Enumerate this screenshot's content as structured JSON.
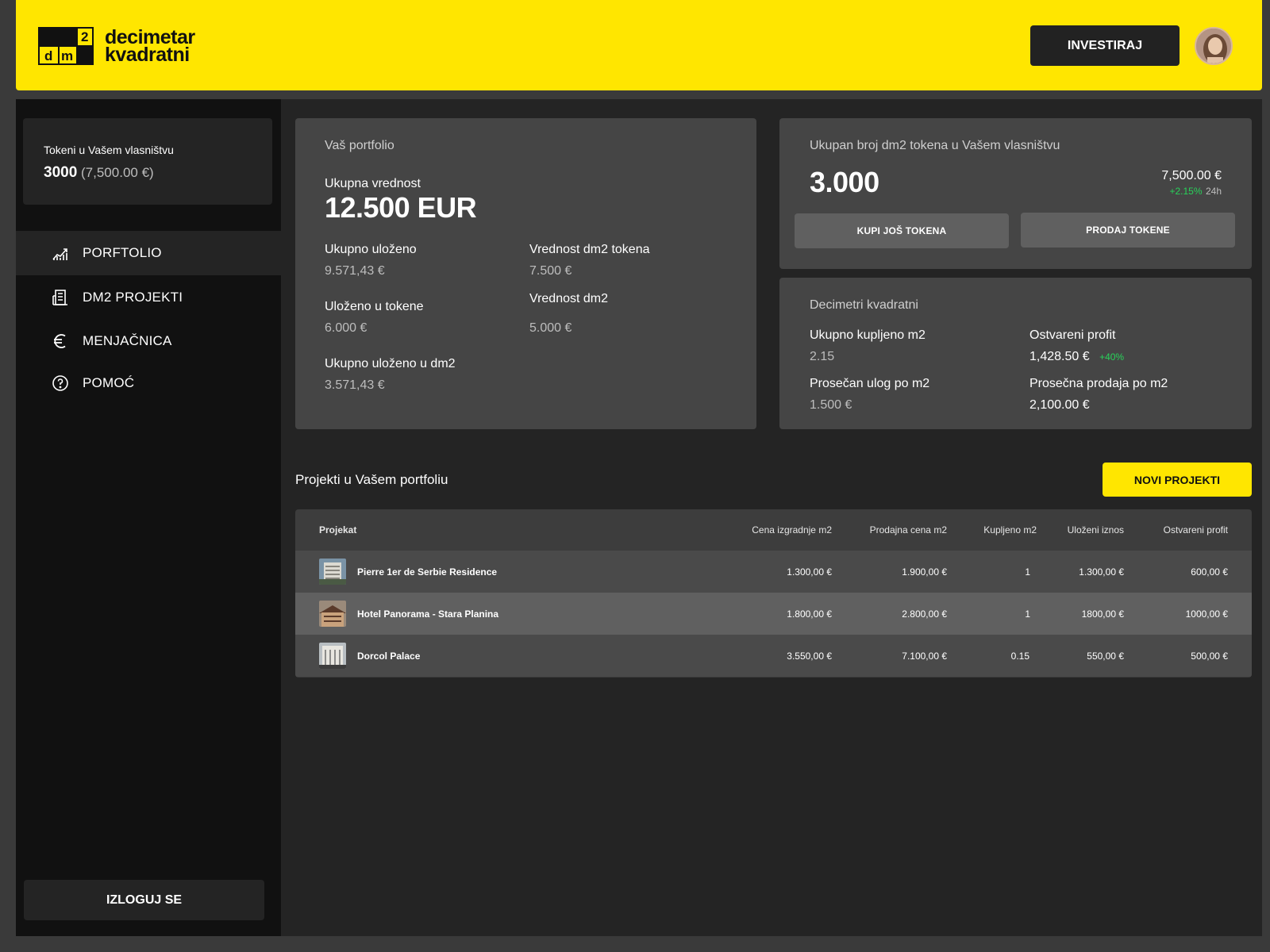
{
  "brand": {
    "logo_text_1": "decimetar",
    "logo_text_2": "kvadratni",
    "mark_sup": "2",
    "mark_d": "d",
    "mark_m": "m"
  },
  "header": {
    "invest_label": "INVESTIRAJ"
  },
  "sidebar": {
    "tokens_label": "Tokeni u Vašem vlasništvu",
    "tokens_count": "3000",
    "tokens_value": "(7,500.00 €)",
    "nav": [
      {
        "label": "PORFTOLIO",
        "icon": "chart-icon",
        "active": true
      },
      {
        "label": "DM2 PROJEKTI",
        "icon": "building-icon",
        "active": false
      },
      {
        "label": "MENJAČNICA",
        "icon": "euro-icon",
        "active": false
      },
      {
        "label": "POMOĆ",
        "icon": "help-icon",
        "active": false
      }
    ],
    "logout_label": "IZLOGUJ SE"
  },
  "portfolio": {
    "title": "Vaš portfolio",
    "total_label": "Ukupna vrednost",
    "total_value": "12.500 EUR",
    "invested_label": "Ukupno uloženo",
    "invested_value": "9.571,43 €",
    "token_value_label": "Vrednost dm2 tokena",
    "token_value": "7.500 €",
    "in_tokens_label": "Uloženo u tokene",
    "in_tokens_value": "6.000 €",
    "dm2_value_label": "Vrednost dm2",
    "dm2_value": "5.000 €",
    "in_dm2_label": "Ukupno uloženo u dm2",
    "in_dm2_value": "3.571,43 €"
  },
  "tokens_card": {
    "title": "Ukupan broj dm2 tokena u Vašem vlasništvu",
    "count": "3.000",
    "value": "7,500.00 €",
    "change": "+2.15%",
    "period": "24h",
    "buy_label": "KUPI JOŠ TOKENA",
    "sell_label": "PRODAJ TOKENE"
  },
  "dm2_card": {
    "title": "Decimetri kvadratni",
    "bought_label": "Ukupno kupljeno m2",
    "bought_value": "2.15",
    "profit_label": "Ostvareni profit",
    "profit_value": "1,428.50 €",
    "profit_change": "+40%",
    "avg_in_label": "Prosečan ulog po m2",
    "avg_in_value": "1.500 €",
    "avg_sale_label": "Prosečna prodaja po m2",
    "avg_sale_value": "2,100.00 €"
  },
  "projects": {
    "section_title": "Projekti u Vašem portfoliu",
    "new_projects_label": "NOVI PROJEKTI",
    "columns": [
      "Projekat",
      "Cena izgradnje m2",
      "Prodajna cena m2",
      "Kupljeno m2",
      "Uloženi iznos",
      "Ostvareni profit"
    ],
    "rows": [
      {
        "name": "Pierre 1er de Serbie Residence",
        "build_price": "1.300,00 €",
        "sale_price": "1.900,00 €",
        "bought": "1",
        "invested": "1.300,00 €",
        "profit": "600,00 €"
      },
      {
        "name": "Hotel Panorama - Stara Planina",
        "build_price": "1.800,00 €",
        "sale_price": "2.800,00 €",
        "bought": "1",
        "invested": "1800,00 €",
        "profit": "1000,00 €"
      },
      {
        "name": "Dorcol Palace",
        "build_price": "3.550,00 €",
        "sale_price": "7.100,00 €",
        "bought": "0.15",
        "invested": "550,00 €",
        "profit": "500,00 €"
      }
    ]
  },
  "colors": {
    "accent": "#ffe600",
    "positive": "#28d35a",
    "sidebar": "#111111",
    "card": "#454545"
  }
}
